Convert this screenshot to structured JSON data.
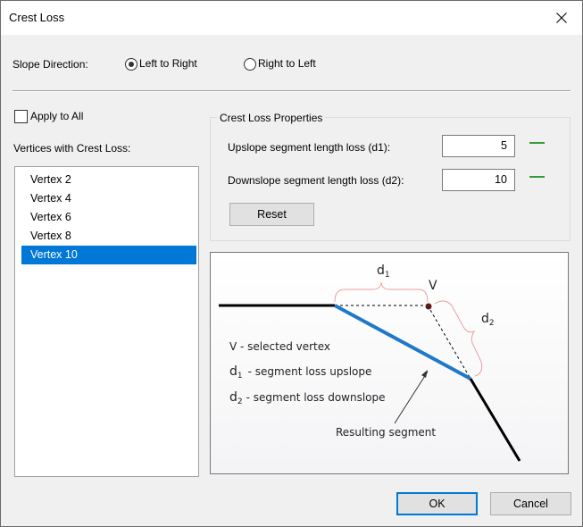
{
  "window": {
    "title": "Crest Loss",
    "close_icon": "close-icon"
  },
  "slope_direction": {
    "label": "Slope Direction:",
    "options": [
      {
        "label": "Left to Right",
        "checked": true
      },
      {
        "label": "Right to Left",
        "checked": false
      }
    ]
  },
  "apply_to_all": {
    "label": "Apply to All",
    "checked": false
  },
  "vertices": {
    "label": "Vertices with Crest Loss:",
    "items": [
      "Vertex 2",
      "Vertex 4",
      "Vertex 6",
      "Vertex 8",
      "Vertex 10"
    ],
    "selected": "Vertex 10"
  },
  "properties": {
    "title": "Crest Loss Properties",
    "upslope_label": "Upslope segment length loss (d1):",
    "upslope_value": "5",
    "downslope_label": "Downslope segment length loss (d2):",
    "downslope_value": "10",
    "reset_label": "Reset"
  },
  "diagram": {
    "d1": "d",
    "d1_sub": "1",
    "d2": "d",
    "d2_sub": "2",
    "v": "V",
    "legend_v": "V  - selected vertex",
    "legend_d1": "- segment loss upslope",
    "legend_d2": "- segment loss downslope",
    "resulting": "Resulting segment",
    "colors": {
      "segment": "#1f78c8",
      "line": "#000000",
      "brace": "#e8a0a0",
      "vertex": "#5a1a1a"
    }
  },
  "footer": {
    "ok_label": "OK",
    "cancel_label": "Cancel"
  }
}
